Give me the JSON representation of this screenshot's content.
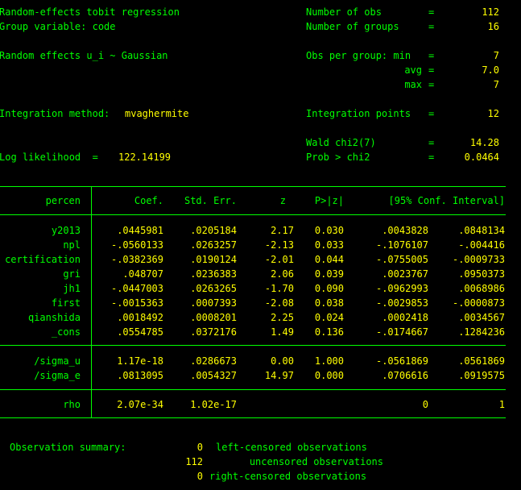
{
  "header": {
    "title": "Random-effects tobit regression",
    "group_variable": "Group variable: code",
    "re_dist": "Random effects u_i ~ Gaussian",
    "integration_method_label": "Integration method:",
    "integration_method_value": "mvaghermite",
    "loglik_label": "Log likelihood  =",
    "loglik_value": "122.14199",
    "stats": [
      {
        "label": "Number of obs",
        "eq": "=",
        "value": "112"
      },
      {
        "label": "Number of groups",
        "eq": "=",
        "value": "16"
      },
      {
        "label": "Obs per group: min",
        "eq": "=",
        "value": "7"
      },
      {
        "label": "avg",
        "eq": "=",
        "value": "7.0"
      },
      {
        "label": "max",
        "eq": "=",
        "value": "7"
      },
      {
        "label": "Integration points",
        "eq": "=",
        "value": "12"
      },
      {
        "label": "Wald chi2(7)",
        "eq": "=",
        "value": "14.28"
      },
      {
        "label": "Prob > chi2",
        "eq": "=",
        "value": "0.0464"
      }
    ]
  },
  "table": {
    "depvar": "percen",
    "columns": [
      "Coef.",
      "Std. Err.",
      "z",
      "P>|z|",
      "[95% Conf. Interval]"
    ],
    "rows": [
      {
        "name": "y2013",
        "coef": ".0445981",
        "se": ".0205184",
        "z": "2.17",
        "p": "0.030",
        "lo": ".0043828",
        "hi": ".0848134"
      },
      {
        "name": "npl",
        "coef": "-.0560133",
        "se": ".0263257",
        "z": "-2.13",
        "p": "0.033",
        "lo": "-.1076107",
        "hi": "-.004416"
      },
      {
        "name": "certification",
        "coef": "-.0382369",
        "se": ".0190124",
        "z": "-2.01",
        "p": "0.044",
        "lo": "-.0755005",
        "hi": "-.0009733"
      },
      {
        "name": "gri",
        "coef": ".048707",
        "se": ".0236383",
        "z": "2.06",
        "p": "0.039",
        "lo": ".0023767",
        "hi": ".0950373"
      },
      {
        "name": "jh1",
        "coef": "-.0447003",
        "se": ".0263265",
        "z": "-1.70",
        "p": "0.090",
        "lo": "-.0962993",
        "hi": ".0068986"
      },
      {
        "name": "first",
        "coef": "-.0015363",
        "se": ".0007393",
        "z": "-2.08",
        "p": "0.038",
        "lo": "-.0029853",
        "hi": "-.0000873"
      },
      {
        "name": "qianshida",
        "coef": ".0018492",
        "se": ".0008201",
        "z": "2.25",
        "p": "0.024",
        "lo": ".0002418",
        "hi": ".0034567"
      },
      {
        "name": "_cons",
        "coef": ".0554785",
        "se": ".0372176",
        "z": "1.49",
        "p": "0.136",
        "lo": "-.0174667",
        "hi": ".1284236"
      }
    ],
    "sigma_rows": [
      {
        "name": "/sigma_u",
        "coef": "1.17e-18",
        "se": ".0286673",
        "z": "0.00",
        "p": "1.000",
        "lo": "-.0561869",
        "hi": ".0561869"
      },
      {
        "name": "/sigma_e",
        "coef": ".0813095",
        "se": ".0054327",
        "z": "14.97",
        "p": "0.000",
        "lo": ".0706616",
        "hi": ".0919575"
      }
    ],
    "rho": {
      "name": "rho",
      "coef": "2.07e-34",
      "se": "1.02e-17",
      "lo": "0",
      "hi": "1"
    }
  },
  "summary": {
    "label": "Observation summary:",
    "lines": [
      {
        "count": "0",
        "desc": "left-censored observations"
      },
      {
        "count": "112",
        "desc": "uncensored observations"
      },
      {
        "count": "0",
        "desc": "right-censored observations"
      }
    ]
  },
  "colors": {
    "text": "#ffff00",
    "label": "#00ff00",
    "background": "#000000"
  }
}
